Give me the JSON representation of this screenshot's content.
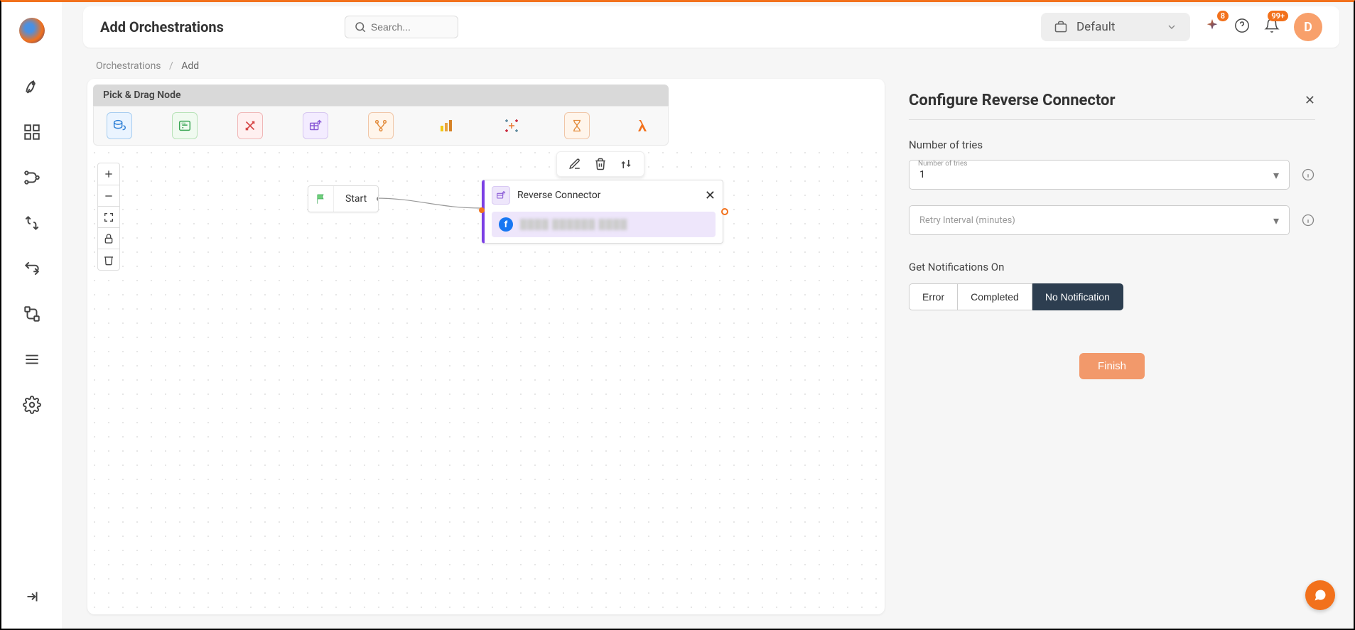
{
  "header": {
    "title": "Add Orchestrations",
    "search_placeholder": "Search...",
    "workspace_label": "Default",
    "sparkle_badge": "8",
    "notif_badge": "99+",
    "avatar_letter": "D"
  },
  "breadcrumb": {
    "parent": "Orchestrations",
    "current": "Add"
  },
  "palette": {
    "header": "Pick & Drag Node"
  },
  "canvas": {
    "start_label": "Start",
    "rc_title": "Reverse Connector",
    "rc_blur_text": "████ ██████ ████"
  },
  "right_panel": {
    "title": "Configure Reverse Connector",
    "tries_section": "Number of tries",
    "tries_float_label": "Number of tries",
    "tries_value": "1",
    "retry_float_label": "Retry Interval (minutes)",
    "retry_value": "",
    "notif_section": "Get Notifications On",
    "notif_options": {
      "error": "Error",
      "completed": "Completed",
      "none": "No Notification"
    },
    "finish": "Finish"
  }
}
